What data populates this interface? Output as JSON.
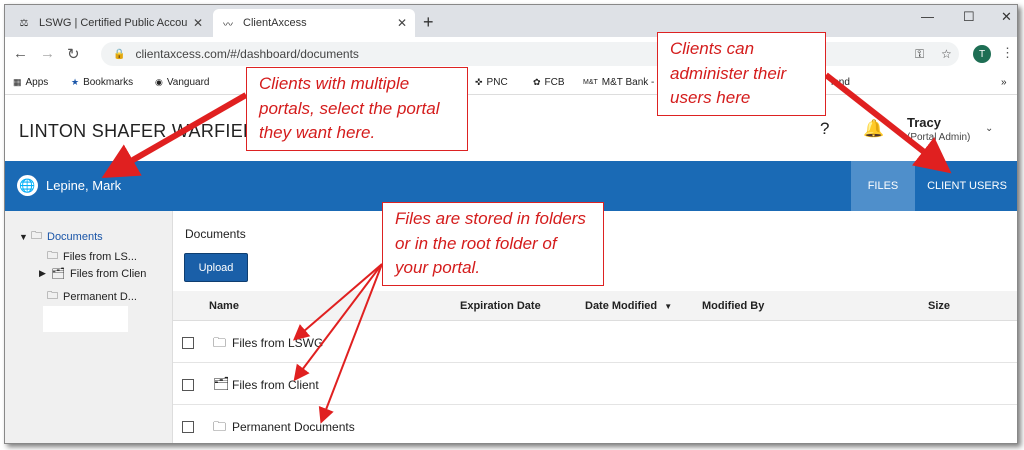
{
  "browser": {
    "tabs": [
      {
        "label": "LSWG | Certified Public Accounta",
        "close": "✕"
      },
      {
        "label": "ClientAxcess",
        "close": "✕"
      }
    ],
    "new_tab": "+",
    "url": "clientaxcess.com/#/dashboard/documents",
    "profile_initial": "T",
    "bookmarks": [
      "Apps",
      "Bookmarks",
      "Vanguard",
      "PNC",
      "FCB",
      "M&T Bank -",
      "land",
      "»"
    ]
  },
  "app": {
    "brand": "LINTON SHAFER WARFIELD",
    "user_name": "Tracy",
    "user_role": "(Portal Admin)",
    "client_name": "Lepine, Mark",
    "nav": {
      "files": "FILES",
      "client_users": "CLIENT USERS"
    }
  },
  "tree": {
    "root": "Documents",
    "children": [
      "Files from LS...",
      "Files from Clien",
      "Permanent D..."
    ]
  },
  "main": {
    "breadcrumb": "Documents",
    "upload_label": "Upload",
    "columns": [
      "Name",
      "Expiration Date",
      "Date Modified",
      "Modified By",
      "Size"
    ],
    "rows": [
      {
        "name": "Files from LSWG"
      },
      {
        "name": "Files from Client"
      },
      {
        "name": "Permanent Documents"
      }
    ]
  },
  "annotations": {
    "portals": "Clients with multiple portals, select the portal they want here.",
    "users": "Clients can administer their users here",
    "folders": "Files are stored in folders or in the root folder of your portal."
  },
  "colors": {
    "brand_blue": "#1a6ab5",
    "annotation_red": "#e02020"
  }
}
